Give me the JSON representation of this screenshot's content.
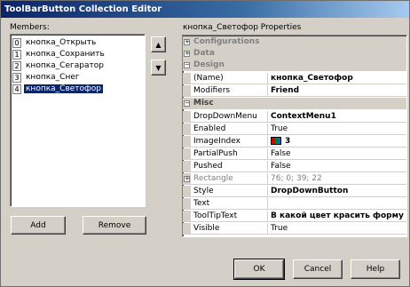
{
  "window": {
    "title": "ToolBarButton Collection Editor"
  },
  "members": {
    "label": "Members:",
    "items": [
      {
        "index": "0",
        "name": "кнопка_Открыть"
      },
      {
        "index": "1",
        "name": "кнопка_Сохранить"
      },
      {
        "index": "2",
        "name": "кнопка_Сегаратор"
      },
      {
        "index": "3",
        "name": "кнопка_Снег"
      },
      {
        "index": "4",
        "name": "кнопка_Светофор",
        "selected": true
      }
    ],
    "up_arrow": "▲",
    "down_arrow": "▼",
    "add_label": "Add",
    "remove_label": "Remove"
  },
  "properties": {
    "label": "кнопка_Светофор Properties",
    "categories": {
      "configurations": "Configurations",
      "data": "Data",
      "design": "Design",
      "misc": "Misc"
    },
    "rows": {
      "name": {
        "name": "(Name)",
        "value": "кнопка_Светофор"
      },
      "modifiers": {
        "name": "Modifiers",
        "value": "Friend"
      },
      "dropdownmenu": {
        "name": "DropDownMenu",
        "value": "ContextMenu1"
      },
      "enabled": {
        "name": "Enabled",
        "value": "True"
      },
      "imageindex": {
        "name": "ImageIndex",
        "value": "3"
      },
      "partialpush": {
        "name": "PartialPush",
        "value": "False"
      },
      "pushed": {
        "name": "Pushed",
        "value": "False"
      },
      "rectangle": {
        "name": "Rectangle",
        "value": "76; 0; 39; 22"
      },
      "style": {
        "name": "Style",
        "value": "DropDownButton"
      },
      "text": {
        "name": "Text",
        "value": ""
      },
      "tooltiptext": {
        "name": "ToolTipText",
        "value": "В какой цвет красить форму"
      },
      "visible": {
        "name": "Visible",
        "value": "True"
      }
    }
  },
  "buttons": {
    "ok": "OK",
    "cancel": "Cancel",
    "help": "Help"
  },
  "expand_glyph": "+",
  "collapse_glyph": "−"
}
